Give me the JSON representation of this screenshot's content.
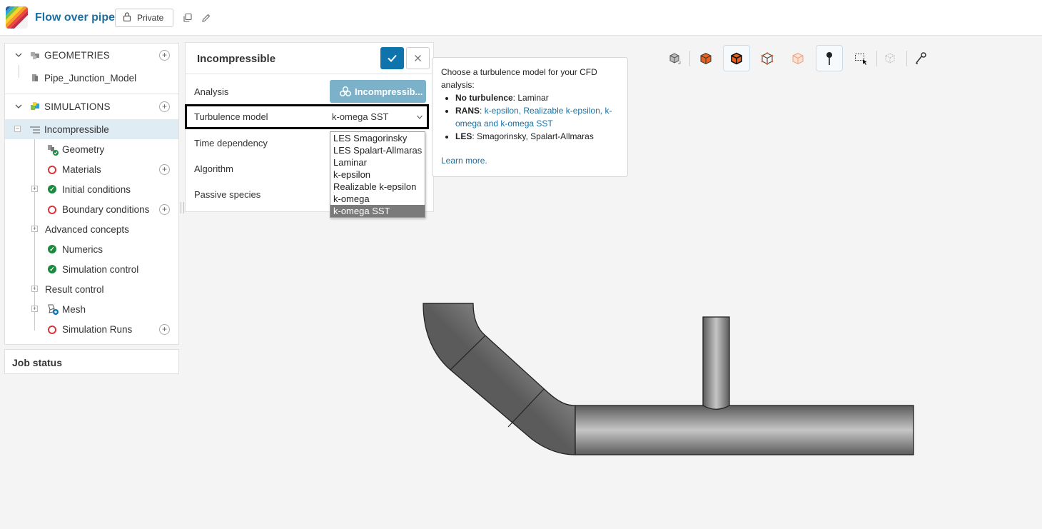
{
  "header": {
    "project_title": "Flow over pipe",
    "privacy_label": "Private"
  },
  "tree": {
    "geometries_title": "GEOMETRIES",
    "geometry_item": "Pipe_Junction_Model",
    "simulations_title": "SIMULATIONS",
    "simulation_item": "Incompressible",
    "children": [
      {
        "label": "Geometry",
        "status": "ok"
      },
      {
        "label": "Materials",
        "status": "error"
      },
      {
        "label": "Initial conditions",
        "status": "ok"
      },
      {
        "label": "Boundary conditions",
        "status": "error"
      },
      {
        "label": "Advanced concepts",
        "status": "none"
      },
      {
        "label": "Numerics",
        "status": "ok"
      },
      {
        "label": "Simulation control",
        "status": "ok"
      },
      {
        "label": "Result control",
        "status": "none"
      },
      {
        "label": "Mesh",
        "status": "mesh"
      },
      {
        "label": "Simulation Runs",
        "status": "error"
      }
    ]
  },
  "job_status": {
    "title": "Job status"
  },
  "property_panel": {
    "title": "Incompressible",
    "rows": {
      "analysis": "Analysis",
      "turbulence": "Turbulence model",
      "time": "Time dependency",
      "algorithm": "Algorithm",
      "passive": "Passive species"
    },
    "analysis_button": "Incompressib...",
    "turbulence_value": "k-omega SST"
  },
  "dropdown": {
    "options": [
      "LES Smagorinsky",
      "LES Spalart-Allmaras",
      "Laminar",
      "k-epsilon",
      "Realizable k-epsilon",
      "k-omega",
      "k-omega SST"
    ],
    "selected": "k-omega SST"
  },
  "tooltip": {
    "intro": "Choose a turbulence model for your CFD analysis:",
    "no_turb_label": "No turbulence",
    "no_turb_text": ": Laminar",
    "rans_label": "RANS",
    "rans_text": "k-epsilon, Realizable k-epsilon, k-omega and k-omega SST",
    "les_label": "LES",
    "les_text": ": Smagorinsky, Spalart-Allmaras",
    "learn_more": "Learn more."
  },
  "colors": {
    "brand": "#1a6fa3",
    "ok": "#1c8a3e",
    "error": "#e0333c",
    "accent_button": "#0f73ac",
    "analysis_button": "#7cb2c9",
    "dropdown_selected": "#7a7a7a"
  }
}
